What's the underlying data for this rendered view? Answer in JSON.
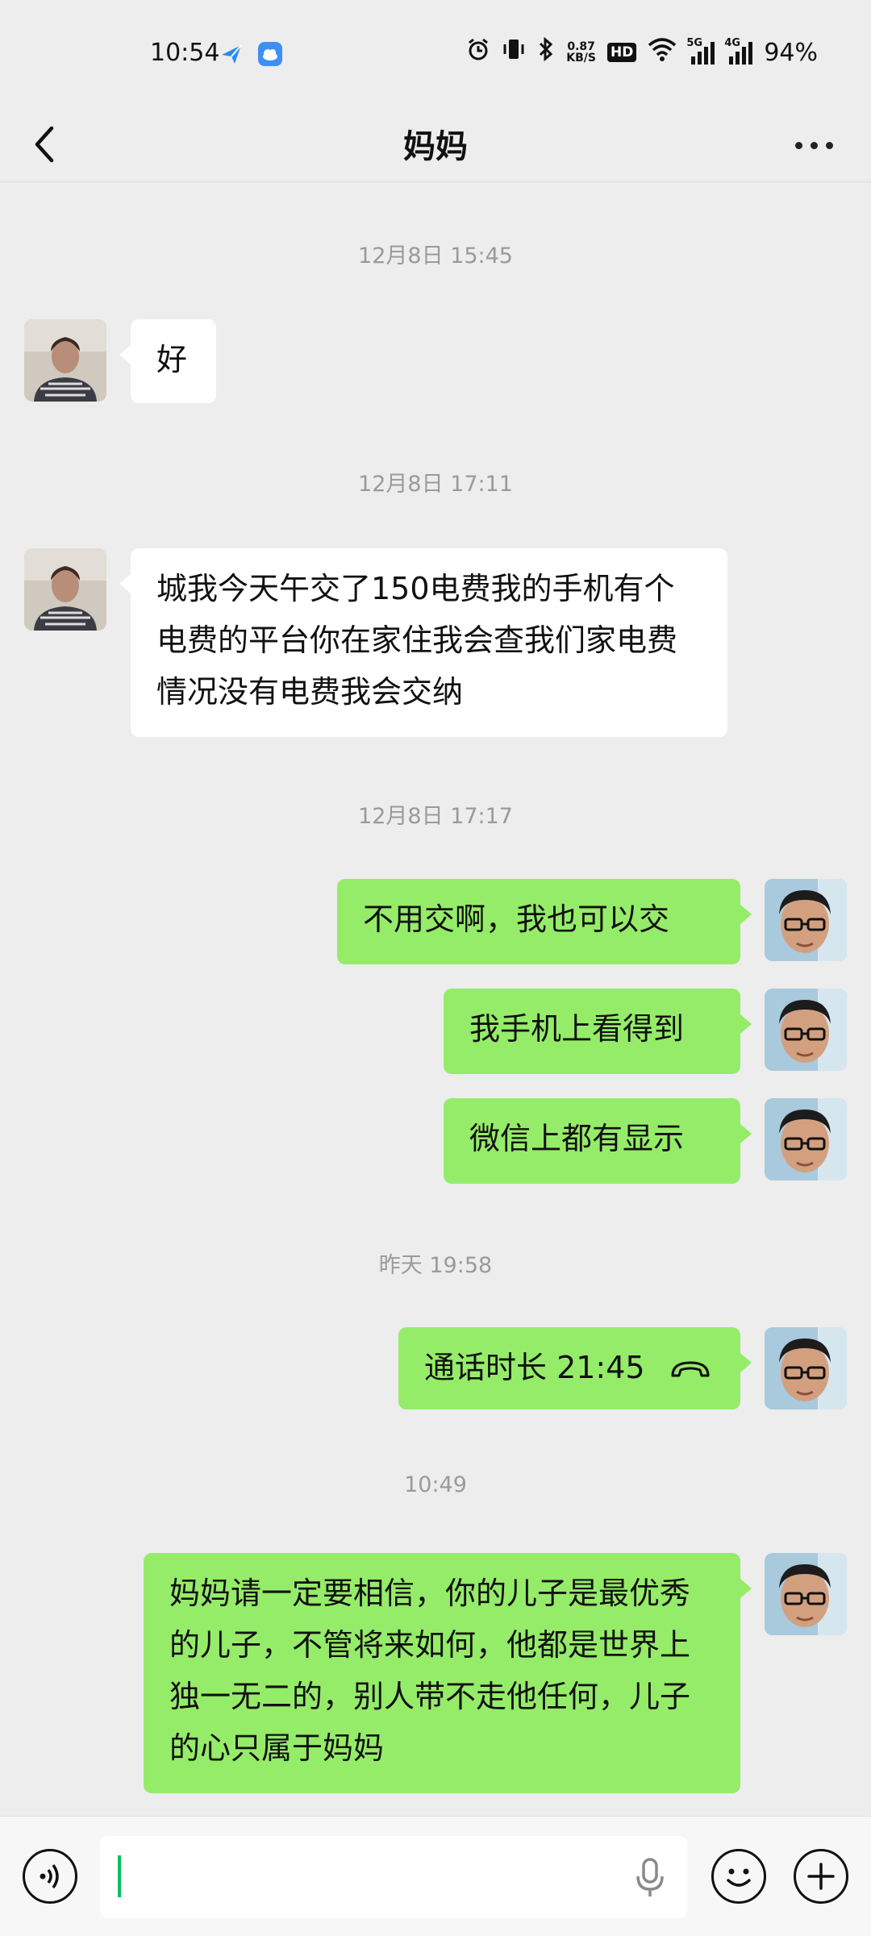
{
  "status_bar": {
    "time": "10:54",
    "speed_value": "0.87",
    "speed_unit": "KB/S",
    "hd": "HD",
    "sig1_tag": "5G",
    "sig2_tag": "4G",
    "battery": "94%"
  },
  "nav": {
    "title": "妈妈"
  },
  "messages": [
    {
      "type": "time",
      "text": "12月8日  15:45"
    },
    {
      "type": "received",
      "text": "好"
    },
    {
      "type": "time",
      "text": "12月8日  17:11"
    },
    {
      "type": "received",
      "text": "城我今天午交了150电费我的手机有个电费的平台你在家住我会查我们家电费情况没有电费我会交纳"
    },
    {
      "type": "time",
      "text": "12月8日  17:17"
    },
    {
      "type": "sent",
      "text": "不用交啊，我也可以交"
    },
    {
      "type": "sent",
      "text": "我手机上看得到"
    },
    {
      "type": "sent",
      "text": "微信上都有显示"
    },
    {
      "type": "time",
      "text": "昨天  19:58"
    },
    {
      "type": "sent_call",
      "text": "通话时长  21:45"
    },
    {
      "type": "time",
      "text": "10:49"
    },
    {
      "type": "sent",
      "text": "妈妈请一定要相信，你的儿子是最优秀的儿子，不管将来如何，他都是世界上独一无二的，别人带不走他任何，儿子的心只属于妈妈"
    }
  ],
  "colors": {
    "background": "#ededed",
    "sent_bubble": "#95ec69",
    "received_bubble": "#ffffff",
    "caret": "#07c160"
  }
}
